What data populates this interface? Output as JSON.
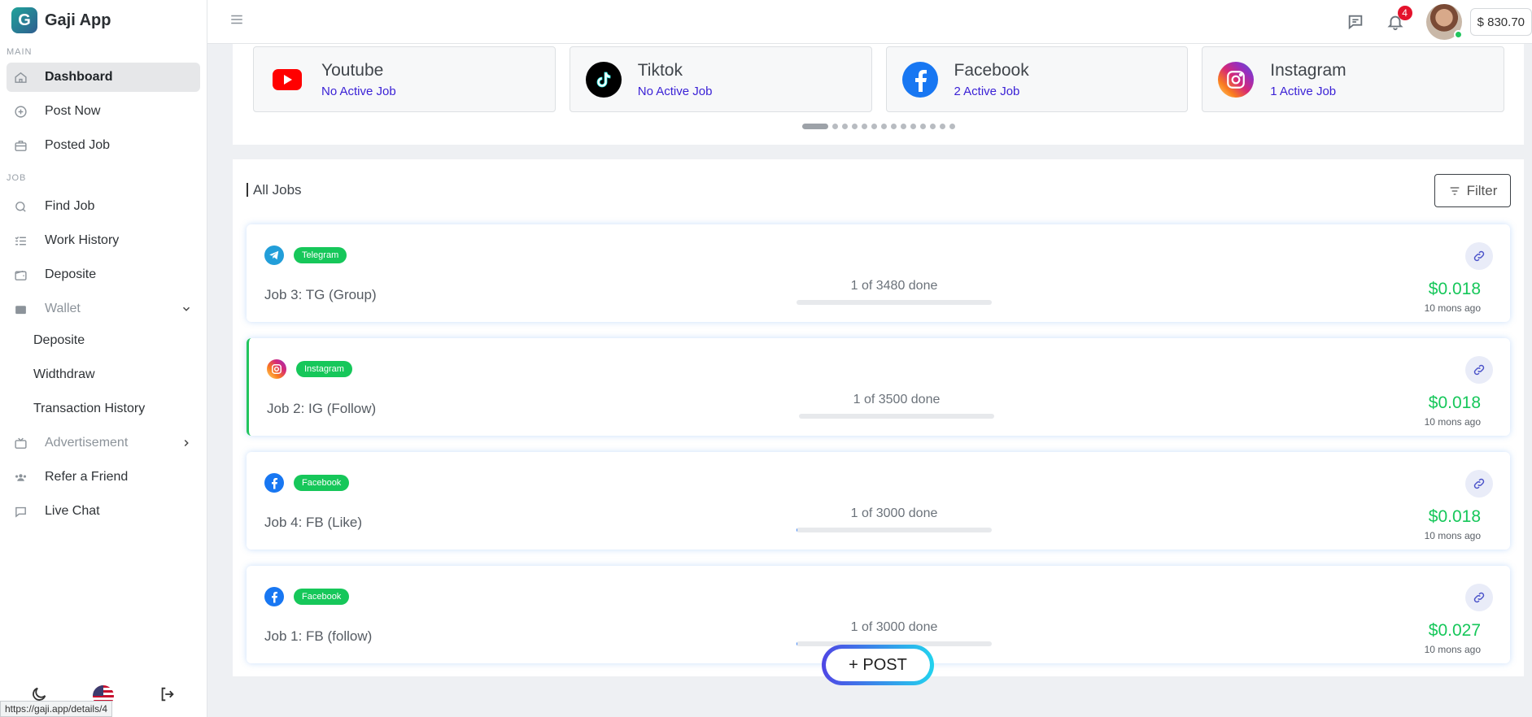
{
  "app": {
    "name": "Gaji App",
    "logo_letter": "G"
  },
  "sidebar": {
    "sections": {
      "main": "MAIN",
      "job": "JOB"
    },
    "items": [
      {
        "label": "Dashboard",
        "icon": "home-icon"
      },
      {
        "label": "Post Now",
        "icon": "plus-circle-icon"
      },
      {
        "label": "Posted Job",
        "icon": "briefcase-icon"
      },
      {
        "label": "Find Job",
        "icon": "search-icon"
      },
      {
        "label": "Work History",
        "icon": "list-check-icon"
      },
      {
        "label": "Deposite",
        "icon": "wallet-icon"
      },
      {
        "label": "Wallet",
        "icon": "wallet-filled-icon"
      },
      {
        "label": "Advertisement",
        "icon": "tv-icon"
      },
      {
        "label": "Refer a Friend",
        "icon": "users-icon"
      },
      {
        "label": "Live Chat",
        "icon": "chat-icon"
      }
    ],
    "wallet_sub": [
      "Deposite",
      "Widthdraw",
      "Transaction History"
    ]
  },
  "topbar": {
    "notifications": "4",
    "balance": "$ 830.70"
  },
  "platforms": [
    {
      "name": "Youtube",
      "status": "No Active Job",
      "color": "#ff0000"
    },
    {
      "name": "Tiktok",
      "status": "No Active Job",
      "color": "#000000"
    },
    {
      "name": "Facebook",
      "status": "2 Active Job",
      "color": "#1877f2"
    },
    {
      "name": "Instagram",
      "status": "1 Active Job",
      "color": "#e1306c"
    }
  ],
  "jobs": {
    "title": "All Jobs",
    "filter_label": "Filter",
    "list": [
      {
        "tag": "Telegram",
        "title": "Job 3: TG (Group)",
        "done": 1,
        "total": 3480,
        "progress_text": "1 of 3480 done",
        "price": "$0.018",
        "ago": "10 mons ago"
      },
      {
        "tag": "Instagram",
        "title": "Job 2: IG (Follow)",
        "done": 1,
        "total": 3500,
        "progress_text": "1 of 3500 done",
        "price": "$0.018",
        "ago": "10 mons ago"
      },
      {
        "tag": "Facebook",
        "title": "Job 4: FB (Like)",
        "done": 1,
        "total": 3000,
        "progress_text": "1 of 3000 done",
        "price": "$0.018",
        "ago": "10 mons ago"
      },
      {
        "tag": "Facebook",
        "title": "Job 1: FB (follow)",
        "done": 1,
        "total": 3000,
        "progress_text": "1 of 3000 done",
        "price": "$0.027",
        "ago": "10 mons ago"
      }
    ]
  },
  "post_button": "+ POST",
  "status_url": "https://gaji.app/details/4"
}
